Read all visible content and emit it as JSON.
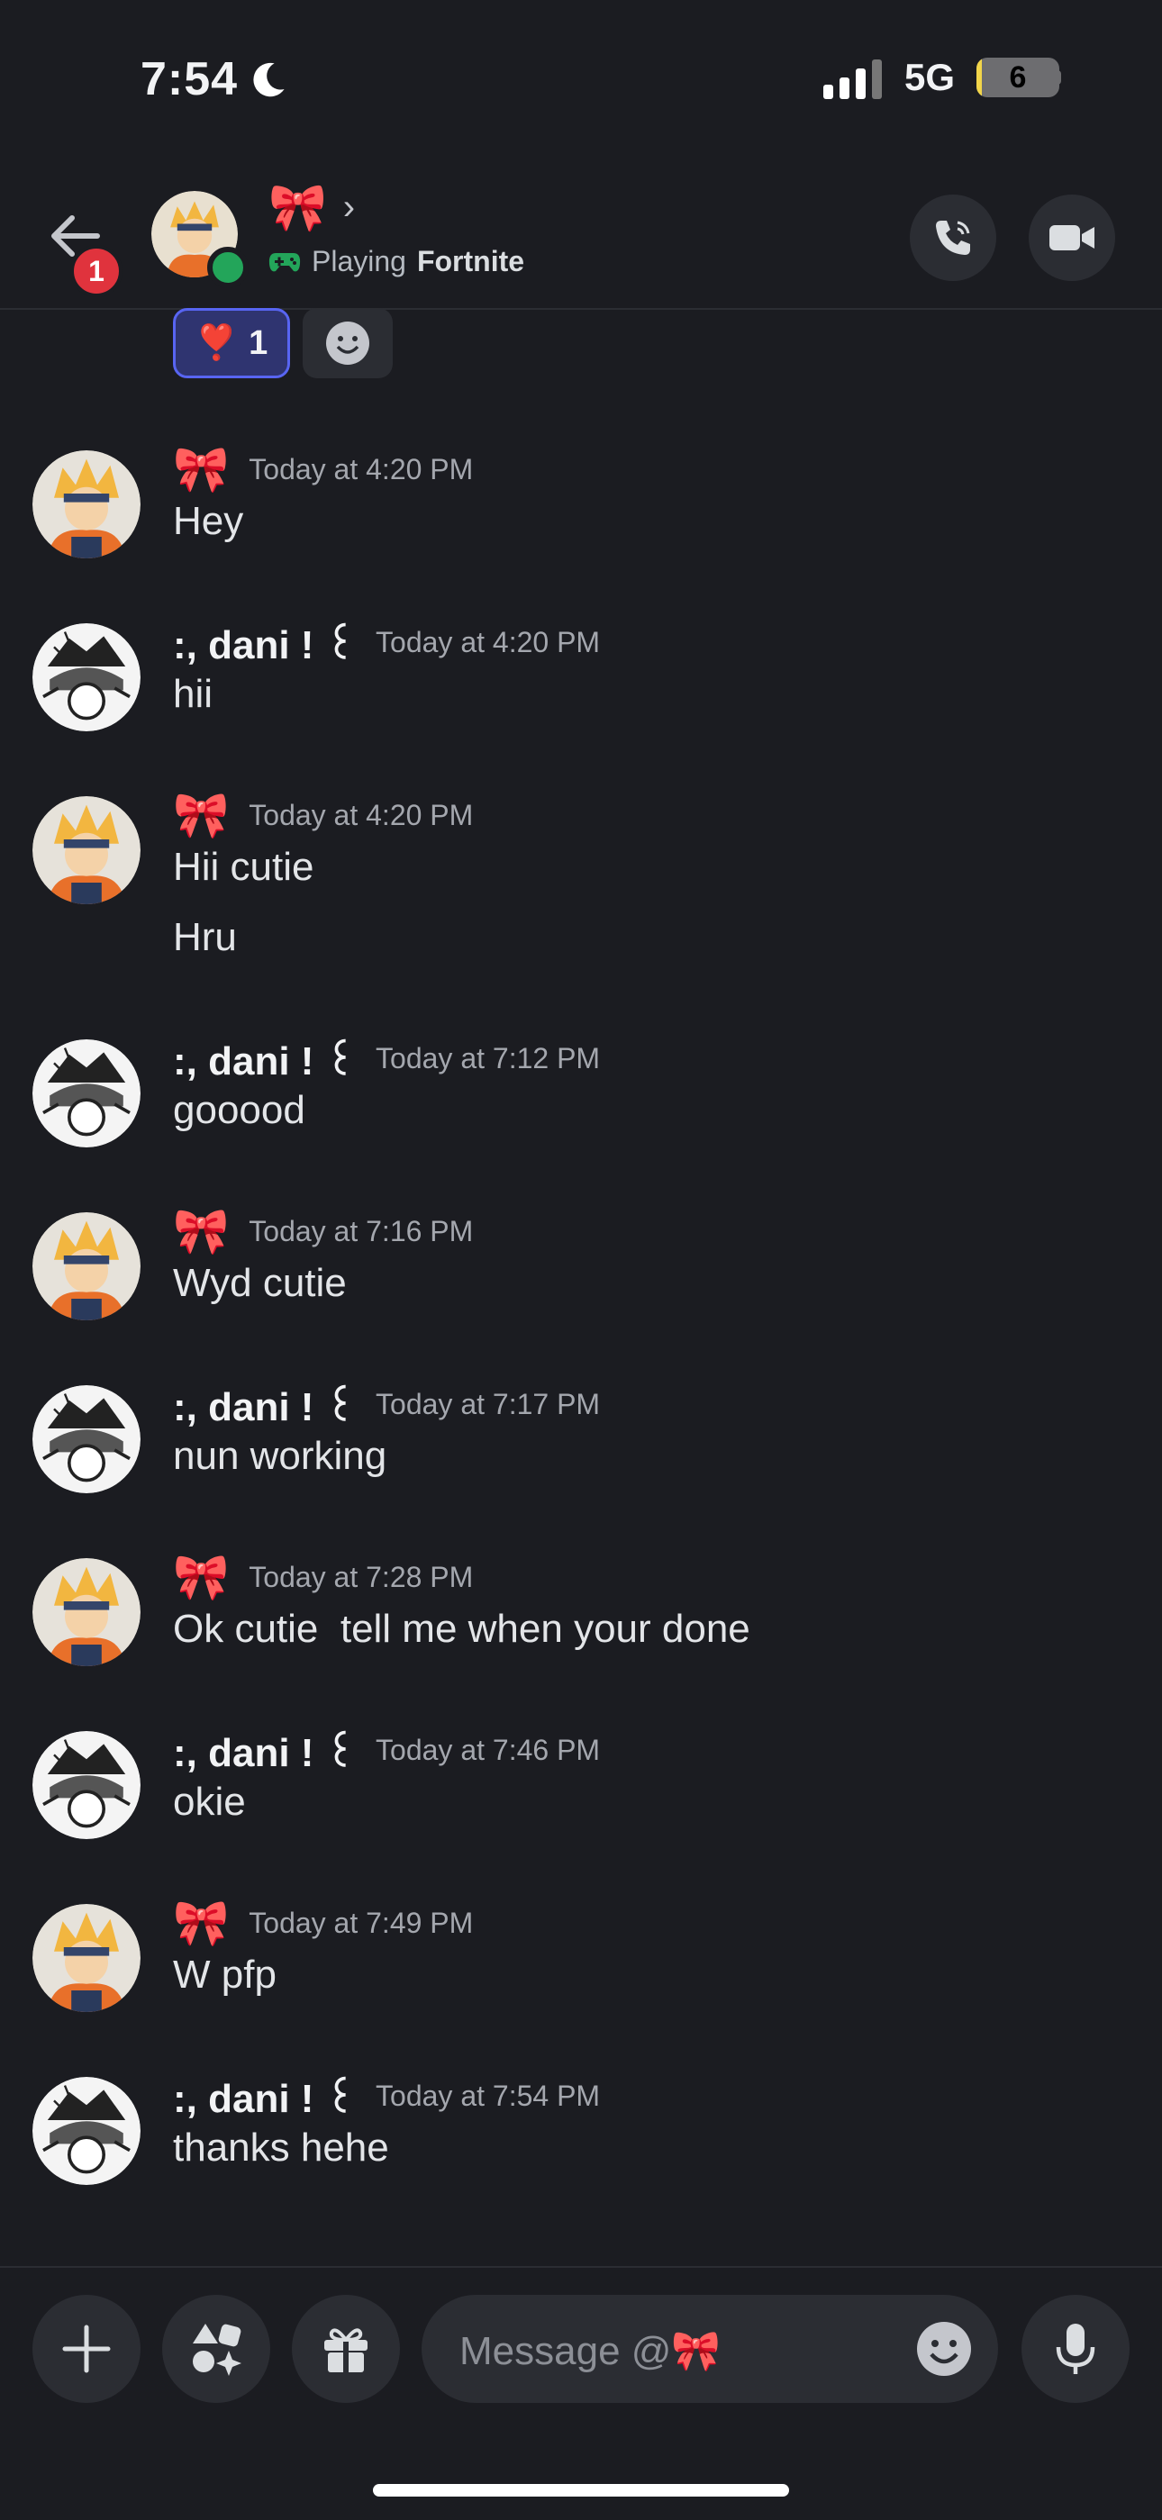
{
  "status_bar": {
    "time": "7:54",
    "network": "5G",
    "battery": "6",
    "battery_level_percent": 6
  },
  "header": {
    "back_badge": "1",
    "name": "🎀",
    "status_prefix": "Playing",
    "status_game": "Fortnite"
  },
  "reactions": {
    "emoji": "❣️",
    "count": "1"
  },
  "messages": [
    {
      "user": "🎀",
      "time": "Today at 4:20 PM",
      "lines": [
        "Hey"
      ]
    },
    {
      "user": ":, dani ! ꒰",
      "time": "Today at 4:20 PM",
      "lines": [
        "hii"
      ]
    },
    {
      "user": "🎀",
      "time": "Today at 4:20 PM",
      "lines": [
        "Hii cutie",
        "Hru"
      ]
    },
    {
      "user": ":, dani ! ꒰",
      "time": "Today at 7:12 PM",
      "lines": [
        "gooood"
      ]
    },
    {
      "user": "🎀",
      "time": "Today at 7:16 PM",
      "lines": [
        "Wyd cutie"
      ]
    },
    {
      "user": ":, dani ! ꒰",
      "time": "Today at 7:17 PM",
      "lines": [
        "nun working"
      ]
    },
    {
      "user": "🎀",
      "time": "Today at 7:28 PM",
      "lines": [
        "Ok cutie  tell me when your done"
      ]
    },
    {
      "user": ":, dani ! ꒰",
      "time": "Today at 7:46 PM",
      "lines": [
        "okie"
      ]
    },
    {
      "user": "🎀",
      "time": "Today at 7:49 PM",
      "lines": [
        "W pfp"
      ]
    },
    {
      "user": ":, dani ! ꒰",
      "time": "Today at 7:54 PM",
      "lines": [
        "thanks hehe"
      ]
    }
  ],
  "composer": {
    "placeholder": "Message @🎀"
  },
  "colors": {
    "background": "#1b1c21",
    "accent": "#5865f2",
    "online": "#23a55a",
    "badge": "#e0333d"
  }
}
